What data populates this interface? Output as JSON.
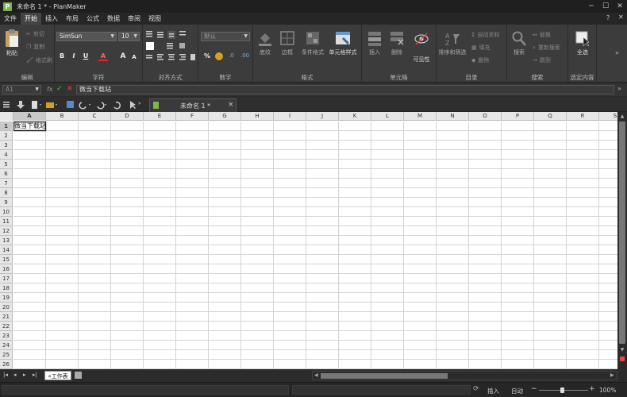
{
  "window": {
    "title": "未命名 1 * - PlanMaker",
    "app_icon_letter": "P",
    "help_glyph": "?"
  },
  "menu": {
    "tabs": [
      "文件",
      "开始",
      "插入",
      "布局",
      "公式",
      "数据",
      "审阅",
      "视图"
    ],
    "active_index": 1
  },
  "ribbon": {
    "edit": {
      "label": "编辑",
      "paste": "粘贴",
      "cut": "剪切",
      "copy": "复制",
      "format_painter": "格式刷"
    },
    "font": {
      "label": "字符",
      "font_name": "SimSun",
      "font_size": "10",
      "bold": "B",
      "italic": "I",
      "underline": "U",
      "color": "A",
      "grow": "A",
      "shrink": "A"
    },
    "align": {
      "label": "对齐方式"
    },
    "number": {
      "label": "数字",
      "format": "默认",
      "percent": "%"
    },
    "format": {
      "label": "格式",
      "fill": "底纹",
      "border": "边框",
      "conditional": "条件格式",
      "cell_style": "单元格样式",
      "visibility": "可见性"
    },
    "cells": {
      "label": "单元格",
      "insert": "插入",
      "delete": "删除"
    },
    "list": {
      "label": "目录",
      "sort_filter": "排序和筛选",
      "autosum": "自动求和",
      "fill": "填充",
      "delete": "删除"
    },
    "search": {
      "label": "搜索",
      "search": "搜索",
      "replace": "替换",
      "research": "重新搜索",
      "goto": "跳到"
    },
    "select": {
      "label": "选定内容",
      "select_all": "全选"
    }
  },
  "formula_bar": {
    "cell_ref": "A1",
    "fx": "fx",
    "content": "微当下载站"
  },
  "document_tab": {
    "label": "未命名 1 *",
    "close": "×"
  },
  "grid": {
    "columns": [
      "A",
      "B",
      "C",
      "D",
      "E",
      "F",
      "G",
      "H",
      "I",
      "J",
      "K",
      "L",
      "M",
      "N",
      "O",
      "P",
      "Q",
      "R",
      "S"
    ],
    "rows": [
      "1",
      "2",
      "3",
      "4",
      "5",
      "6",
      "7",
      "8",
      "9",
      "10",
      "11",
      "12",
      "13",
      "14",
      "15",
      "16",
      "17",
      "18",
      "19",
      "20",
      "21",
      "22",
      "23",
      "24",
      "25",
      "26"
    ],
    "selected_column": "A",
    "selected_row": "1",
    "cell_a1": "微当下载站"
  },
  "sheets": {
    "active": "工作表 1"
  },
  "status": {
    "mode": "插入",
    "calc": "自动",
    "zoom": "100%"
  },
  "colors": {
    "accent": "#7ab648",
    "ribbon_bg": "#3c3c3c",
    "chrome_bg": "#2b2b2b"
  }
}
